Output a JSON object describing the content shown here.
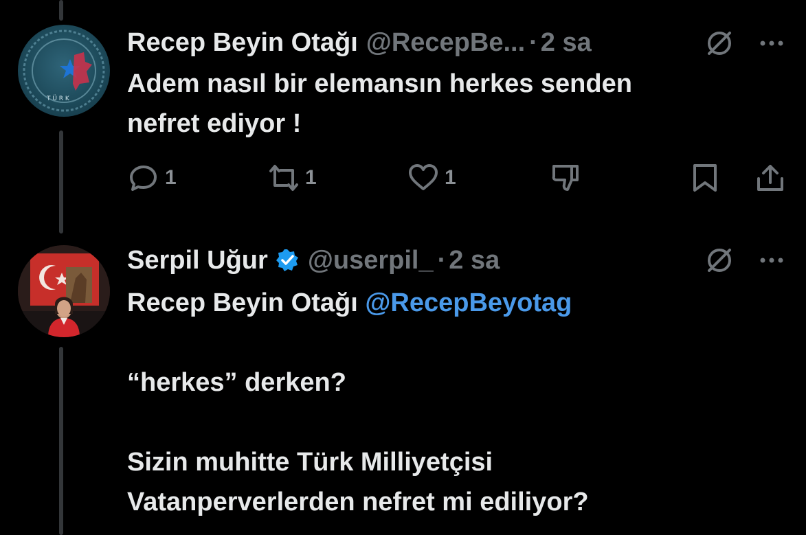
{
  "tweets": [
    {
      "author": {
        "name": "Recep Beyin Otağı",
        "handle": "@RecepBe...",
        "avatar": "emblem-avatar"
      },
      "dot": "·",
      "time": "2 sa",
      "text": "Adem nasıl bir elemansın herkes senden\nnefret ediyor !",
      "actions": {
        "replies": "1",
        "reposts": "1",
        "likes": "1"
      }
    },
    {
      "author": {
        "name": "Serpil Uğur",
        "handle": "@userpil_",
        "verified": true,
        "avatar": "portrait-avatar"
      },
      "dot": "·",
      "time": "2 sa",
      "text_before_mention": "Recep Beyin Otağı ",
      "mention": "@RecepBeyotag",
      "text_after_mention": "\n\n“herkes” derken?\n\nSizin muhitte Türk Milliyetçisi\nVatanperverlerden nefret mi ediliyor?"
    }
  ],
  "colors": {
    "background": "#000000",
    "text": "#e7e9ea",
    "muted": "#71767b",
    "link": "#4a99e9",
    "verified": "#1d9bf0",
    "thread_line": "#333639"
  },
  "icons": [
    "grok-icon",
    "more-icon",
    "reply-icon",
    "repost-icon",
    "like-icon",
    "dislike-icon",
    "bookmark-icon",
    "share-icon",
    "verified-badge-icon"
  ]
}
